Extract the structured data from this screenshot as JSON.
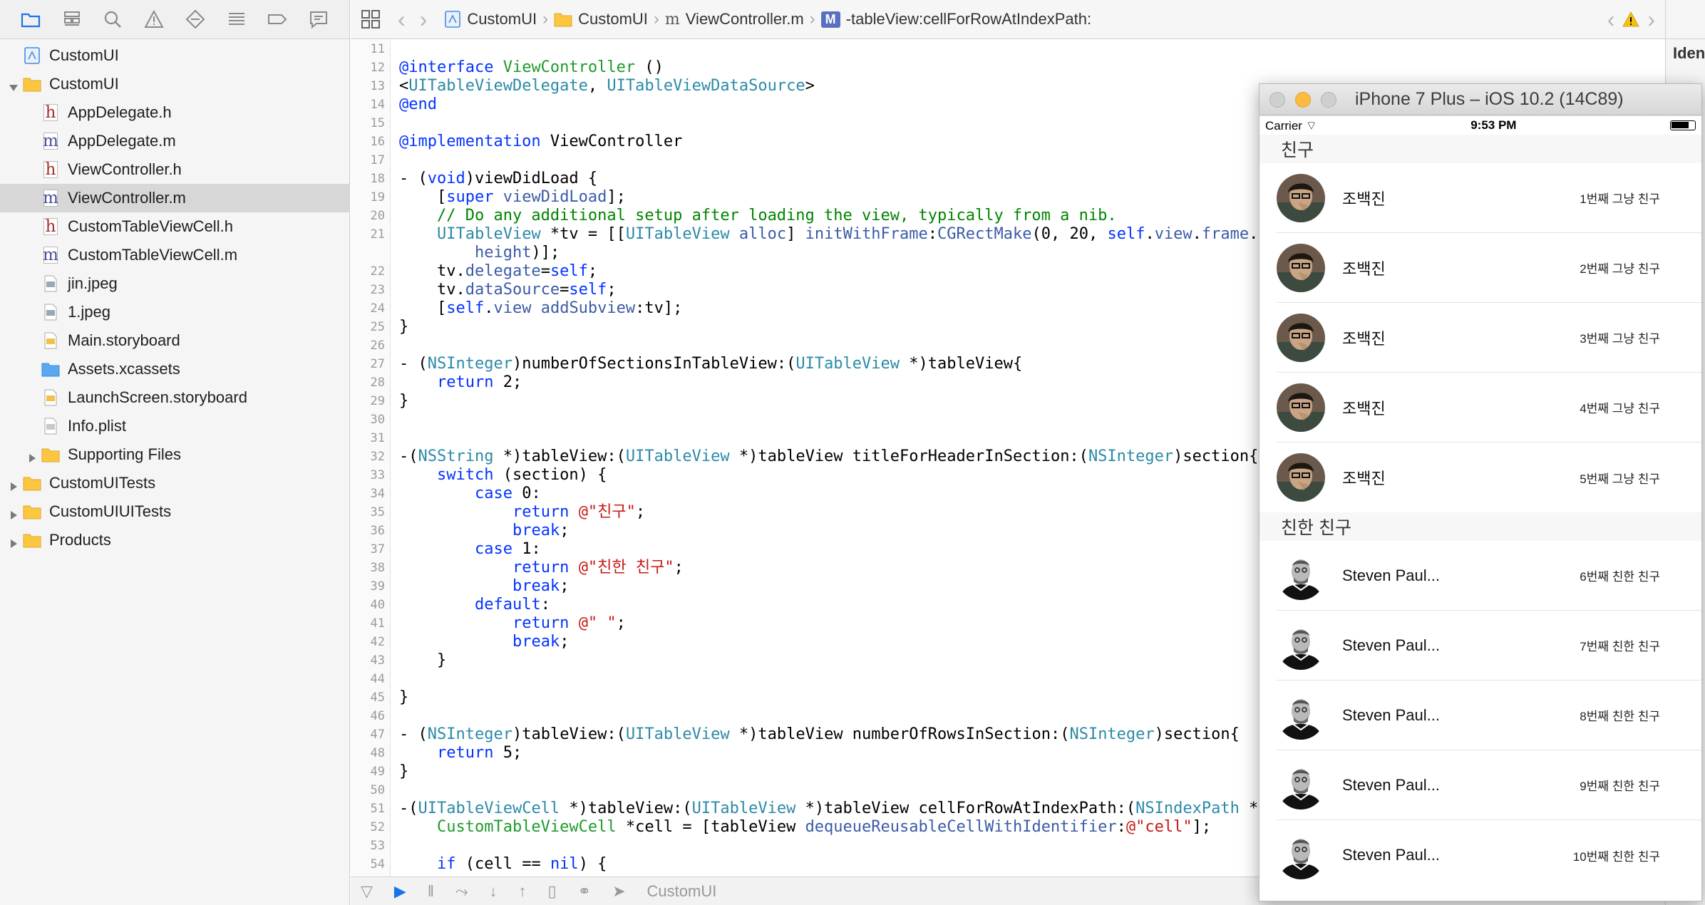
{
  "navigator": {
    "toolbar_icons": [
      "folder-icon",
      "hierarchy-icon",
      "search-icon",
      "warning-icon",
      "test-icon",
      "debug-icon",
      "breakpoint-icon",
      "report-icon"
    ],
    "items": [
      {
        "label": "CustomUI",
        "kind": "project",
        "depth": 0,
        "disc": "none"
      },
      {
        "label": "CustomUI",
        "kind": "folder",
        "depth": 0,
        "disc": "open"
      },
      {
        "label": "AppDelegate.h",
        "kind": "h",
        "depth": 1,
        "disc": "none"
      },
      {
        "label": "AppDelegate.m",
        "kind": "m",
        "depth": 1,
        "disc": "none"
      },
      {
        "label": "ViewController.h",
        "kind": "h",
        "depth": 1,
        "disc": "none"
      },
      {
        "label": "ViewController.m",
        "kind": "m",
        "depth": 1,
        "disc": "none",
        "selected": true
      },
      {
        "label": "CustomTableViewCell.h",
        "kind": "h",
        "depth": 1,
        "disc": "none"
      },
      {
        "label": "CustomTableViewCell.m",
        "kind": "m",
        "depth": 1,
        "disc": "none"
      },
      {
        "label": "jin.jpeg",
        "kind": "jpeg",
        "depth": 1,
        "disc": "none"
      },
      {
        "label": "1.jpeg",
        "kind": "jpeg",
        "depth": 1,
        "disc": "none"
      },
      {
        "label": "Main.storyboard",
        "kind": "storyboard",
        "depth": 1,
        "disc": "none"
      },
      {
        "label": "Assets.xcassets",
        "kind": "assets",
        "depth": 1,
        "disc": "none"
      },
      {
        "label": "LaunchScreen.storyboard",
        "kind": "storyboard",
        "depth": 1,
        "disc": "none"
      },
      {
        "label": "Info.plist",
        "kind": "plist",
        "depth": 1,
        "disc": "none"
      },
      {
        "label": "Supporting Files",
        "kind": "folder",
        "depth": 1,
        "disc": "closed"
      },
      {
        "label": "CustomUITests",
        "kind": "folder",
        "depth": 0,
        "disc": "closed"
      },
      {
        "label": "CustomUIUITests",
        "kind": "folder",
        "depth": 0,
        "disc": "closed"
      },
      {
        "label": "Products",
        "kind": "folder",
        "depth": 0,
        "disc": "closed"
      }
    ]
  },
  "jumpbar": {
    "crumbs": [
      "CustomUI",
      "CustomUI",
      "ViewController.m",
      "-tableView:cellForRowAtIndexPath:"
    ],
    "method_badge": "M"
  },
  "editor": {
    "lines": [
      {
        "n": "11",
        "t": ""
      },
      {
        "n": "12",
        "t": "<k>@interface</k> <g>ViewController</g> ()"
      },
      {
        "n": "13",
        "t": "&lt;<ty>UITableViewDelegate</ty>, <ty>UITableViewDataSource</ty>&gt;"
      },
      {
        "n": "14",
        "t": "<k>@end</k>"
      },
      {
        "n": "15",
        "t": ""
      },
      {
        "n": "16",
        "t": "<k>@implementation</k> ViewController"
      },
      {
        "n": "17",
        "t": ""
      },
      {
        "n": "18",
        "t": "- (<k>void</k>)viewDidLoad {"
      },
      {
        "n": "19",
        "t": "    [<k>super</k> <m>viewDidLoad</m>];"
      },
      {
        "n": "20",
        "t": "    <c>// Do any additional setup after loading the view, typically from a nib.</c>"
      },
      {
        "n": "21",
        "t": "    <ty>UITableView</ty> *tv = [[<ty>UITableView</ty> <m>alloc</m>] <m>initWithFrame</m>:<m>CGRectMake</m>(0, 20, <k>self</k>.<m>view</m>.<m>frame</m>.<m>size</m>.<m>width</m>, <k>self</k>.<m>view</m>.<m>frame</m>.<m>size</m>."
      },
      {
        "n": "",
        "t": "        <m>height</m>)];"
      },
      {
        "n": "22",
        "t": "    tv.<m>delegate</m>=<k>self</k>;"
      },
      {
        "n": "23",
        "t": "    tv.<m>dataSource</m>=<k>self</k>;"
      },
      {
        "n": "24",
        "t": "    [<k>self</k>.<m>view</m> <m>addSubview</m>:tv];"
      },
      {
        "n": "25",
        "t": "}"
      },
      {
        "n": "26",
        "t": ""
      },
      {
        "n": "27",
        "t": "- (<ty>NSInteger</ty>)numberOfSectionsInTableView:(<ty>UITableView</ty> *)tableView{"
      },
      {
        "n": "28",
        "t": "    <k>return</k> 2;"
      },
      {
        "n": "29",
        "t": "}"
      },
      {
        "n": "30",
        "t": ""
      },
      {
        "n": "31",
        "t": ""
      },
      {
        "n": "32",
        "t": "-(<ty>NSString</ty> *)tableView:(<ty>UITableView</ty> *)tableView titleForHeaderInSection:(<ty>NSInteger</ty>)section{"
      },
      {
        "n": "33",
        "t": "    <k>switch</k> (section) {"
      },
      {
        "n": "34",
        "t": "        <k>case</k> 0:"
      },
      {
        "n": "35",
        "t": "            <k>return</k> <s>@\"친구\"</s>;"
      },
      {
        "n": "36",
        "t": "            <k>break</k>;"
      },
      {
        "n": "37",
        "t": "        <k>case</k> 1:"
      },
      {
        "n": "38",
        "t": "            <k>return</k> <s>@\"친한 친구\"</s>;"
      },
      {
        "n": "39",
        "t": "            <k>break</k>;"
      },
      {
        "n": "40",
        "t": "        <k>default</k>:"
      },
      {
        "n": "41",
        "t": "            <k>return</k> <s>@\" \"</s>;"
      },
      {
        "n": "42",
        "t": "            <k>break</k>;"
      },
      {
        "n": "43",
        "t": "    }"
      },
      {
        "n": "44",
        "t": ""
      },
      {
        "n": "45",
        "t": "}"
      },
      {
        "n": "46",
        "t": ""
      },
      {
        "n": "47",
        "t": "- (<ty>NSInteger</ty>)tableView:(<ty>UITableView</ty> *)tableView numberOfRowsInSection:(<ty>NSInteger</ty>)section{"
      },
      {
        "n": "48",
        "t": "    <k>return</k> 5;"
      },
      {
        "n": "49",
        "t": "}"
      },
      {
        "n": "50",
        "t": ""
      },
      {
        "n": "51",
        "t": "-(<ty>UITableViewCell</ty> *)tableView:(<ty>UITableView</ty> *)tableView cellForRowAtIndexPath:(<ty>NSIndexPath</ty> *)indexPath{"
      },
      {
        "n": "52",
        "t": "    <g>CustomTableViewCell</g> *cell = [tableView <m>dequeueReusableCellWithIdentifier</m>:<s>@\"cell\"</s>];"
      },
      {
        "n": "53",
        "t": ""
      },
      {
        "n": "54",
        "t": "    <k>if</k> (cell == <k>nil</k>) {"
      }
    ]
  },
  "bottom": {
    "scheme": "CustomUI"
  },
  "inspector": {
    "label": "Ident"
  },
  "simulator": {
    "title": "iPhone 7 Plus – iOS 10.2 (14C89)",
    "status": {
      "carrier": "Carrier",
      "time": "9:53 PM"
    },
    "sections": [
      {
        "header": "친구",
        "avatar": "jin",
        "rows": [
          {
            "name": "조백진",
            "detail": "1번째 그냥 친구"
          },
          {
            "name": "조백진",
            "detail": "2번째 그냥 친구"
          },
          {
            "name": "조백진",
            "detail": "3번째 그냥 친구"
          },
          {
            "name": "조백진",
            "detail": "4번째 그냥 친구"
          },
          {
            "name": "조백진",
            "detail": "5번째 그냥 친구"
          }
        ]
      },
      {
        "header": "친한 친구",
        "avatar": "steve",
        "rows": [
          {
            "name": "Steven Paul...",
            "detail": "6번째 친한 친구"
          },
          {
            "name": "Steven Paul...",
            "detail": "7번째 친한 친구"
          },
          {
            "name": "Steven Paul...",
            "detail": "8번째 친한 친구"
          },
          {
            "name": "Steven Paul...",
            "detail": "9번째 친한 친구"
          },
          {
            "name": "Steven Paul...",
            "detail": "10번째 친한 친구"
          }
        ]
      }
    ]
  }
}
